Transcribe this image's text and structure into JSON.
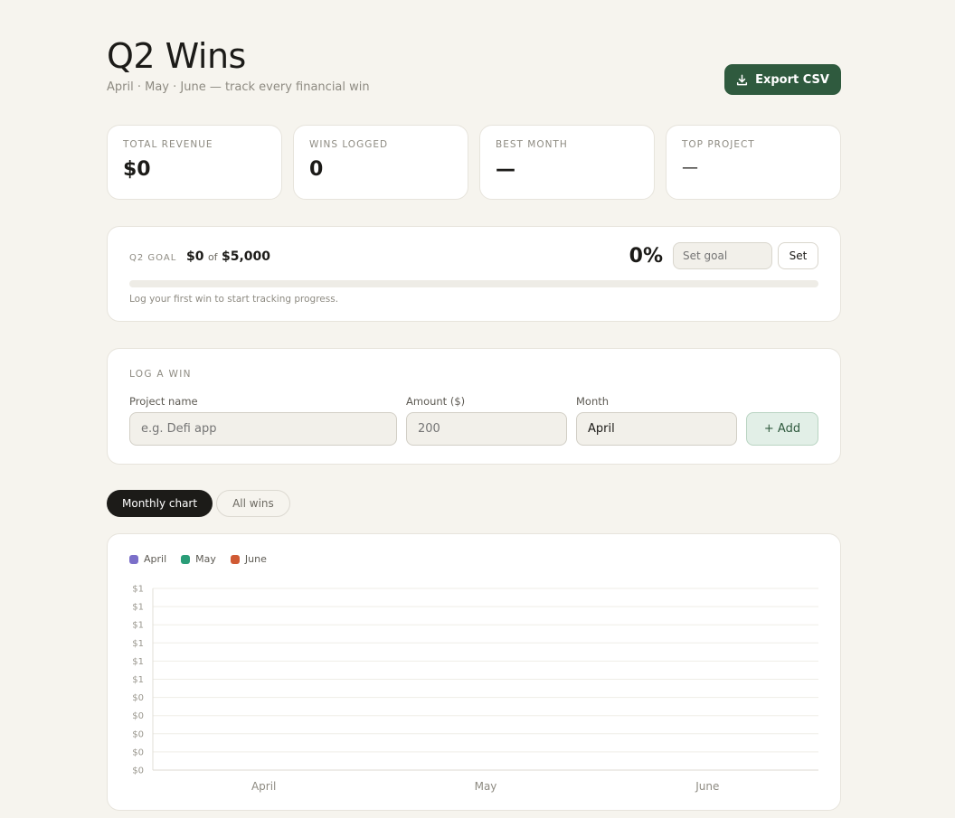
{
  "header": {
    "title": "Q2 Wins",
    "subtitle": "April · May · June — track every financial win",
    "export_label": "Export CSV"
  },
  "stats": [
    {
      "label": "TOTAL REVENUE",
      "value": "$0"
    },
    {
      "label": "WINS LOGGED",
      "value": "0"
    },
    {
      "label": "BEST MONTH",
      "value": "—"
    },
    {
      "label": "TOP PROJECT",
      "value": "—"
    }
  ],
  "goal": {
    "label": "Q2 GOAL",
    "current": "$0",
    "of": "of",
    "target": "$5,000",
    "percent_text": "0%",
    "progress": 0,
    "input_placeholder": "Set goal",
    "set_label": "Set",
    "hint": "Log your first win to start tracking progress."
  },
  "log_win": {
    "title": "LOG A WIN",
    "project_label": "Project name",
    "project_placeholder": "e.g. Defi app",
    "amount_label": "Amount ($)",
    "amount_placeholder": "200",
    "month_label": "Month",
    "month_value": "April",
    "add_label": "+ Add"
  },
  "tabs": [
    {
      "label": "Monthly chart",
      "active": true
    },
    {
      "label": "All wins",
      "active": false
    }
  ],
  "colors": {
    "accent": "#2f5a3e",
    "april": "#7b6fc9",
    "may": "#2a9d78",
    "june": "#d05a34"
  },
  "chart_data": {
    "type": "bar",
    "categories": [
      "April",
      "May",
      "June"
    ],
    "series": [
      {
        "name": "April",
        "values": [
          0,
          0,
          0
        ]
      },
      {
        "name": "May",
        "values": [
          0,
          0,
          0
        ]
      },
      {
        "name": "June",
        "values": [
          0,
          0,
          0
        ]
      }
    ],
    "ytick_labels": [
      "$1",
      "$1",
      "$1",
      "$1",
      "$1",
      "$1",
      "$0",
      "$0",
      "$0",
      "$0",
      "$0"
    ],
    "ylim": [
      0,
      1
    ],
    "grid": true,
    "legend": "top-left"
  }
}
